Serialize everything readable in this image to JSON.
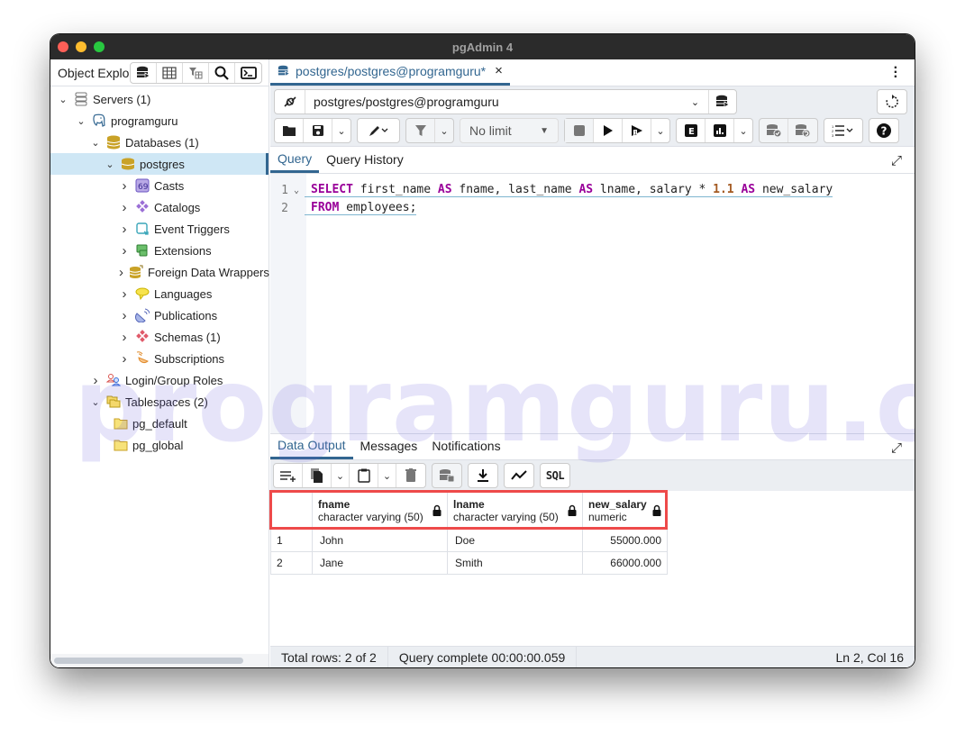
{
  "window": {
    "title": "pgAdmin 4"
  },
  "object_explorer": {
    "title": "Object Explorer",
    "tools": [
      "database-icon",
      "table-icon",
      "filter-table-icon",
      "search-icon",
      "terminal-icon"
    ],
    "tree": [
      {
        "label": "Servers (1)",
        "level": 0,
        "expanded": true,
        "icon": "servers-icon"
      },
      {
        "label": "programguru",
        "level": 1,
        "expanded": true,
        "icon": "postgres-elephant-icon"
      },
      {
        "label": "Databases (1)",
        "level": 2,
        "expanded": true,
        "icon": "databases-icon"
      },
      {
        "label": "postgres",
        "level": 3,
        "expanded": true,
        "icon": "database-icon",
        "selected": true
      },
      {
        "label": "Casts",
        "level": 4,
        "expanded": false,
        "icon": "casts-icon"
      },
      {
        "label": "Catalogs",
        "level": 4,
        "expanded": false,
        "icon": "catalogs-icon"
      },
      {
        "label": "Event Triggers",
        "level": 4,
        "expanded": false,
        "icon": "event-triggers-icon"
      },
      {
        "label": "Extensions",
        "level": 4,
        "expanded": false,
        "icon": "extensions-icon"
      },
      {
        "label": "Foreign Data Wrappers",
        "level": 4,
        "expanded": false,
        "icon": "foreign-data-wrappers-icon"
      },
      {
        "label": "Languages",
        "level": 4,
        "expanded": false,
        "icon": "languages-icon"
      },
      {
        "label": "Publications",
        "level": 4,
        "expanded": false,
        "icon": "publications-icon"
      },
      {
        "label": "Schemas (1)",
        "level": 4,
        "expanded": false,
        "icon": "schemas-icon"
      },
      {
        "label": "Subscriptions",
        "level": 4,
        "expanded": false,
        "icon": "subscriptions-icon"
      },
      {
        "label": "Login/Group Roles",
        "level": 2,
        "expanded": false,
        "icon": "roles-icon"
      },
      {
        "label": "Tablespaces (2)",
        "level": 2,
        "expanded": true,
        "icon": "tablespaces-icon"
      },
      {
        "label": "pg_default",
        "level": 3,
        "leaf": true,
        "icon": "folder-icon"
      },
      {
        "label": "pg_global",
        "level": 3,
        "leaf": true,
        "icon": "folder-icon"
      }
    ]
  },
  "query_tab": {
    "label": "postgres/postgres@programguru*",
    "close": "×"
  },
  "connection": {
    "value": "postgres/postgres@programguru"
  },
  "toolbar": {
    "limit_label": "No limit"
  },
  "editor_tabs": [
    "Query",
    "Query History"
  ],
  "editor": {
    "lines": [
      {
        "number": "1",
        "tokens": [
          {
            "t": "SELECT",
            "k": "kw"
          },
          {
            "t": " first_name ",
            "k": ""
          },
          {
            "t": "AS",
            "k": "kw"
          },
          {
            "t": " fname, last_name ",
            "k": ""
          },
          {
            "t": "AS",
            "k": "kw"
          },
          {
            "t": " lname, salary * ",
            "k": ""
          },
          {
            "t": "1.1",
            "k": "num"
          },
          {
            "t": " ",
            "k": ""
          },
          {
            "t": "AS",
            "k": "kw"
          },
          {
            "t": " new_salary",
            "k": ""
          }
        ]
      },
      {
        "number": "2",
        "tokens": [
          {
            "t": "FROM",
            "k": "kw"
          },
          {
            "t": " employees;",
            "k": ""
          }
        ]
      }
    ]
  },
  "output_tabs": [
    "Data Output",
    "Messages",
    "Notifications"
  ],
  "output_toolbar": {
    "sql_label": "SQL"
  },
  "results": {
    "columns": [
      {
        "name": "fname",
        "type": "character varying (50)"
      },
      {
        "name": "lname",
        "type": "character varying (50)"
      },
      {
        "name": "new_salary",
        "type": "numeric"
      }
    ],
    "rows": [
      {
        "n": "1",
        "cells": [
          "John",
          "Doe",
          "55000.000"
        ]
      },
      {
        "n": "2",
        "cells": [
          "Jane",
          "Smith",
          "66000.000"
        ]
      }
    ]
  },
  "status": {
    "total_rows": "Total rows: 2 of 2",
    "query_complete": "Query complete 00:00:00.059",
    "cursor": "Ln 2, Col 16"
  },
  "watermark": "programguru.org",
  "colors": {
    "accent": "#326690",
    "highlight": "#ee4a4a",
    "keyword": "#990099",
    "number": "#a45a22"
  }
}
